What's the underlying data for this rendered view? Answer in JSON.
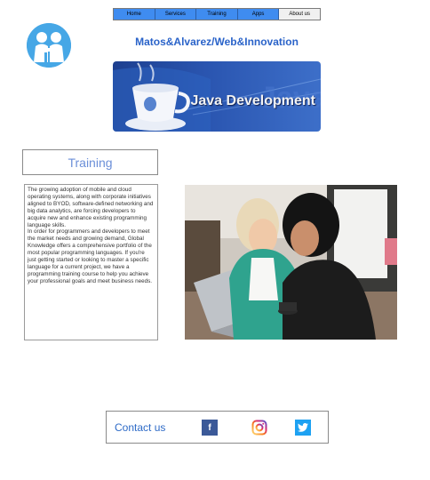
{
  "nav": {
    "items": [
      {
        "label": "Home"
      },
      {
        "label": "Services"
      },
      {
        "label": "Training"
      },
      {
        "label": "Apps"
      },
      {
        "label": "About us"
      }
    ],
    "active_index": 4
  },
  "header": {
    "title": "Matos&Alvarez/Web&Innovation"
  },
  "banner": {
    "text": "Java Development"
  },
  "training": {
    "heading": "Training",
    "paragraph1": "The growing adoption of mobile and cloud operating systems, along with corporate initiatives aligned to BYOD, software-defined networking and big data analytics, are forcing developers to acquire new and enhance existing programming language skills.",
    "paragraph2": "In order for programmers and developers to meet the market needs and growing demand, Global Knowledge offers a comprehensive portfolio of the most popular programming languages. If you're just getting started or looking to master a specific language for a current project, we have a programming training course to help you achieve your professional goals and meet business needs."
  },
  "contact": {
    "label": "Contact us",
    "icons": [
      "facebook-icon",
      "instagram-icon",
      "twitter-icon"
    ]
  },
  "colors": {
    "nav_blue": "#3f8cf0",
    "title_blue": "#2a63c9",
    "heading_blue": "#6b8fd8"
  }
}
